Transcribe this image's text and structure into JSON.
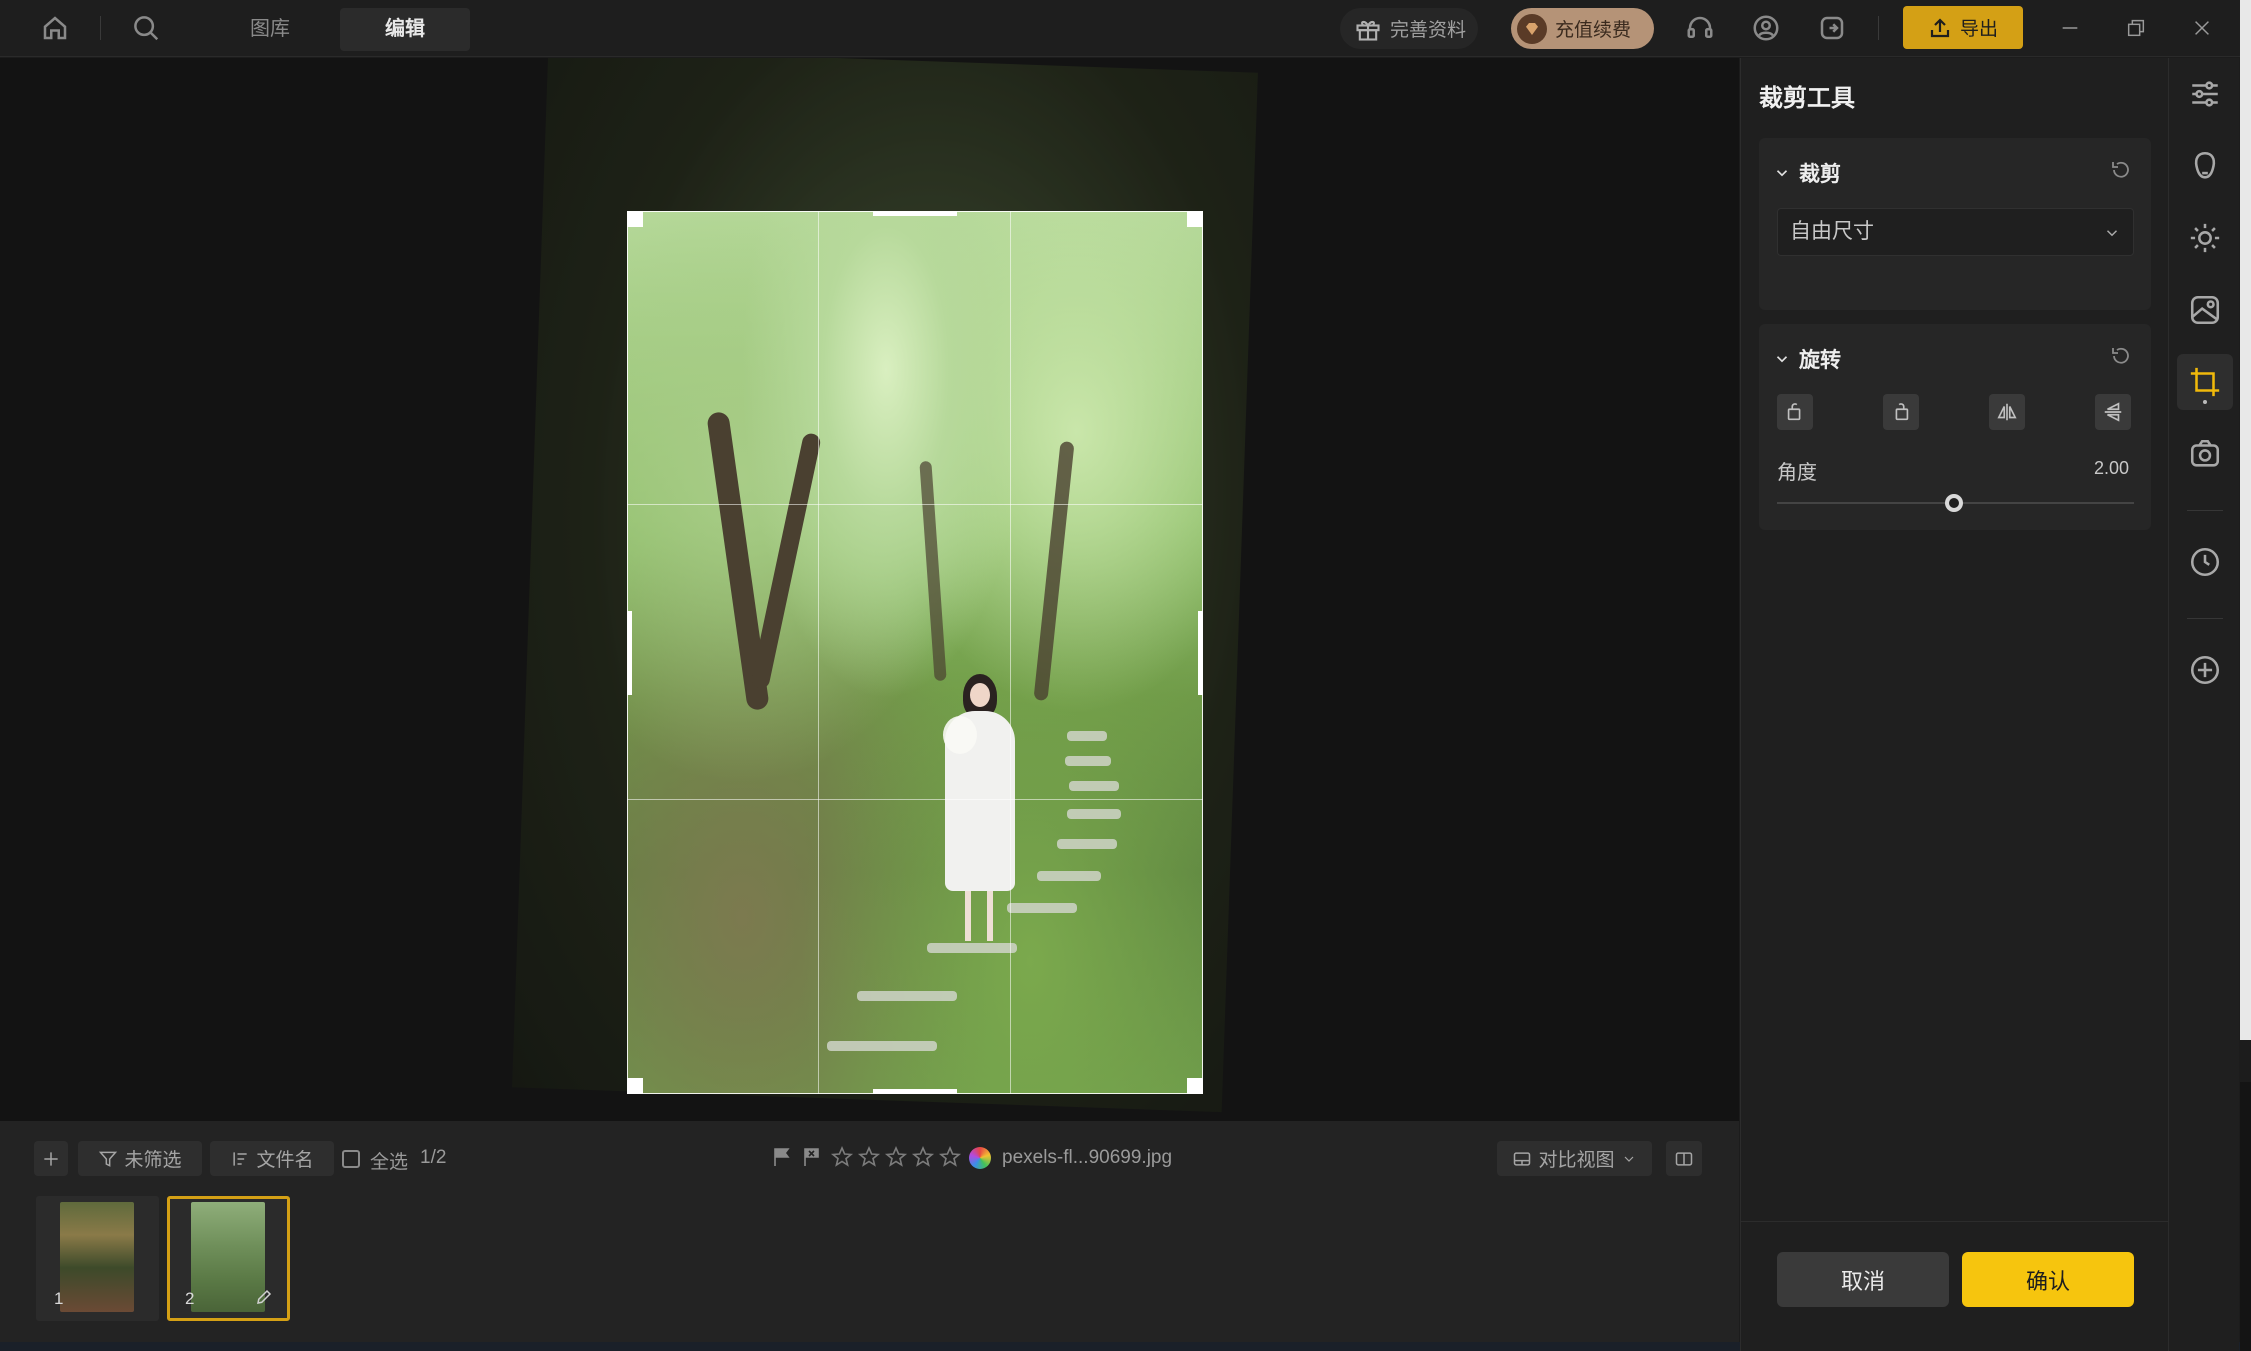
{
  "topbar": {
    "tabs": [
      {
        "label": "图库",
        "active": false
      },
      {
        "label": "编辑",
        "active": true
      }
    ],
    "gift_label": "完善资料",
    "vip_label": "充值续费",
    "export_label": "导出",
    "accent_color": "#d4a015"
  },
  "toolbar": {
    "filter_label": "未筛选",
    "sort_label": "文件名",
    "select_all_label": "全选",
    "select_count": "1/2",
    "filename": "pexels-fl...90699.jpg",
    "compare_view_label": "对比视图",
    "rating_stars": 5
  },
  "filmstrip": {
    "thumbs": [
      {
        "num": "1",
        "selected": false
      },
      {
        "num": "2",
        "selected": true
      }
    ]
  },
  "panel": {
    "title": "裁剪工具",
    "crop_section": {
      "title": "裁剪",
      "ratio_value": "自由尺寸"
    },
    "rotate_section": {
      "title": "旋转",
      "angle_label": "角度",
      "angle_value": "2.00"
    },
    "cancel_label": "取消",
    "confirm_label": "确认",
    "confirm_color": "#f6c50e"
  },
  "rail": {
    "items": [
      "adjust-sliders-icon",
      "face-icon",
      "light-icon",
      "color-icon",
      "crop-icon",
      "camera-icon",
      "history-icon",
      "add-icon"
    ],
    "active": "crop-icon"
  }
}
